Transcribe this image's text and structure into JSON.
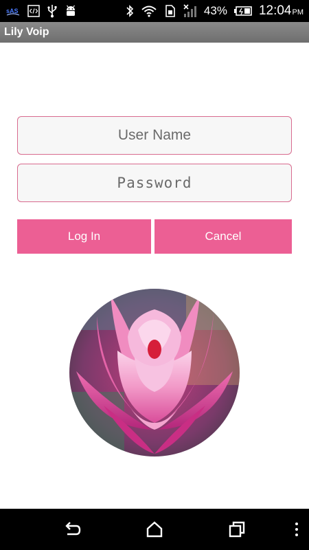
{
  "status_bar": {
    "left_icons": [
      "sas-app-icon",
      "code-icon",
      "usb-icon",
      "android-icon"
    ],
    "right_icons": [
      "bluetooth-icon",
      "wifi-icon",
      "sim-icon",
      "signal-icon",
      "battery-icon"
    ],
    "battery_percent": "43%",
    "time": "12:04",
    "ampm": "PM"
  },
  "app_bar": {
    "title": "Lily Voip"
  },
  "form": {
    "username_placeholder": "User Name",
    "password_placeholder": "Password",
    "login_label": "Log In",
    "cancel_label": "Cancel"
  },
  "colors": {
    "accent": "#ec5f94",
    "field_border": "#d86a8e",
    "action_bar": "#7a7a7a"
  },
  "nav_bar": {
    "icons": [
      "back-icon",
      "home-icon",
      "recent-apps-icon",
      "overflow-menu-icon"
    ]
  }
}
